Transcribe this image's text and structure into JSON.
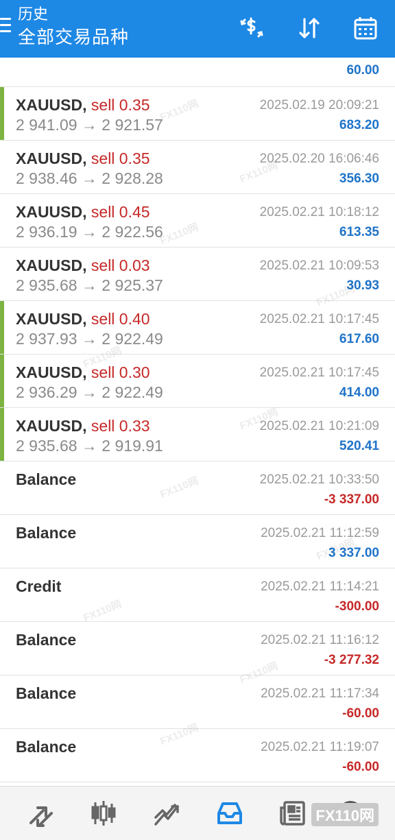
{
  "header": {
    "title": "历史",
    "subtitle": "全部交易品种",
    "actions": [
      "currency-exchange-icon",
      "sort-icon",
      "calendar-icon"
    ]
  },
  "top_entry": {
    "profit": "60.00"
  },
  "trades": [
    {
      "symbol": "XAUUSD,",
      "direction": "sell 0.35",
      "prices": "2 941.09 → 2 921.57",
      "time": "2025.02.19 20:09:21",
      "profit": "683.20"
    },
    {
      "symbol": "XAUUSD,",
      "direction": "sell 0.35",
      "prices": "2 938.46 → 2 928.28",
      "time": "2025.02.20 16:06:46",
      "profit": "356.30"
    },
    {
      "symbol": "XAUUSD,",
      "direction": "sell 0.45",
      "prices": "2 936.19 → 2 922.56",
      "time": "2025.02.21 10:18:12",
      "profit": "613.35"
    },
    {
      "symbol": "XAUUSD,",
      "direction": "sell 0.03",
      "prices": "2 935.68 → 2 925.37",
      "time": "2025.02.21 10:09:53",
      "profit": "30.93"
    },
    {
      "symbol": "XAUUSD,",
      "direction": "sell 0.40",
      "prices": "2 937.93 → 2 922.49",
      "time": "2025.02.21 10:17:45",
      "profit": "617.60"
    },
    {
      "symbol": "XAUUSD,",
      "direction": "sell 0.30",
      "prices": "2 936.29 → 2 922.49",
      "time": "2025.02.21 10:17:45",
      "profit": "414.00"
    },
    {
      "symbol": "XAUUSD,",
      "direction": "sell 0.33",
      "prices": "2 935.68 → 2 919.91",
      "time": "2025.02.21 10:21:09",
      "profit": "520.41"
    }
  ],
  "operations": [
    {
      "type": "Balance",
      "time": "2025.02.21 10:33:50",
      "amount": "-3 337.00"
    },
    {
      "type": "Balance",
      "time": "2025.02.21 11:12:59",
      "amount": "3 337.00"
    },
    {
      "type": "Credit",
      "time": "2025.02.21 11:14:21",
      "amount": "-300.00"
    },
    {
      "type": "Balance",
      "time": "2025.02.21 11:16:12",
      "amount": "-3 277.32"
    },
    {
      "type": "Balance",
      "time": "2025.02.21 11:17:34",
      "amount": "-60.00"
    },
    {
      "type": "Balance",
      "time": "2025.02.21 11:19:07",
      "amount": "-60.00"
    }
  ],
  "bottom_nav": {
    "items": [
      "quotes-icon",
      "chart-icon",
      "trade-icon",
      "history-icon",
      "news-icon",
      "more-icon"
    ],
    "active": "history-icon",
    "brand": "FX110网"
  },
  "watermark": "FX110网",
  "colors": {
    "header_bg": "#1e88e5",
    "profit_positive": "#1e73c8",
    "profit_negative": "#c62828",
    "sell_text": "#c62828",
    "marker": "#7cb342",
    "active_nav": "#1e88e5"
  }
}
